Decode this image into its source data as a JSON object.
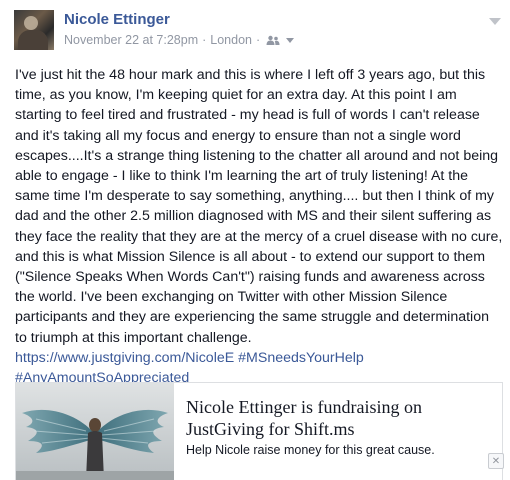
{
  "post": {
    "author": "Nicole Ettinger",
    "date": "November 22 at 7:28pm",
    "separator": "·",
    "location": "London",
    "audience_icon": "friends-icon",
    "body": "I've just hit the 48 hour mark and this is where I left off 3 years ago, but this time, as you know, I'm keeping quiet for an extra day. At this point I am starting to feel tired and frustrated - my head is full of words I can't release and it's taking all my focus and energy to ensure than not a single word escapes....It's a strange thing listening to the chatter all around and not being able to engage - I like to think I'm learning the art of truly listening! At the same time I'm desperate to say something, anything.... but then I think of my dad and the other 2.5 million diagnosed with MS and their silent suffering as they face the reality that they are at the mercy of a cruel disease with no cure, and this is what Mission Silence is all about - to extend our support to them (\"Silence Speaks When Words Can't\") raising funds and awareness across the world. I've been exchanging on Twitter with other Mission Silence participants and they are experiencing the same struggle and determination to triumph at this important challenge.",
    "link_url": "https://www.justgiving.com/NicoleE",
    "hashtag1": "#MSneedsYourHelp",
    "hashtag2": "#AnyAmountSoAppreciated"
  },
  "share_card": {
    "title": "Nicole Ettinger is fundraising on JustGiving for Shift.ms",
    "description": "Help Nicole raise money for this great cause.",
    "image_icon": "angel-wings-mural-image"
  },
  "colors": {
    "link": "#3b5998",
    "meta": "#9197a3",
    "text": "#141823"
  }
}
